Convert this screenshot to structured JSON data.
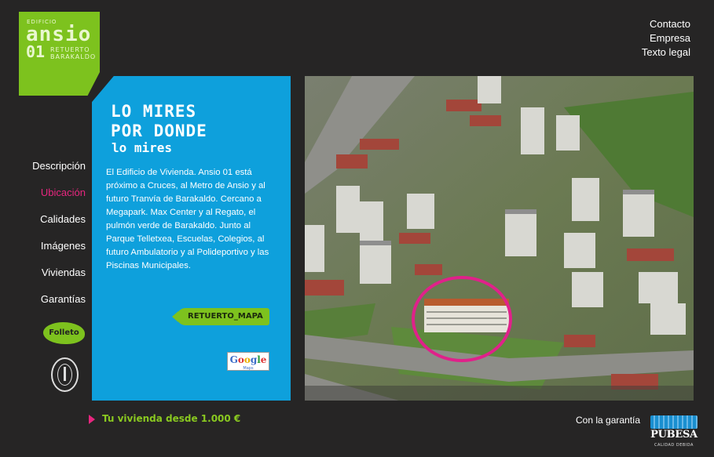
{
  "logo": {
    "small": "EDIFICIO",
    "big": "ansio",
    "number": "01",
    "sub_line1": "RETUERTO",
    "sub_line2": "BARAKALDO"
  },
  "topnav": [
    "Contacto",
    "Empresa",
    "Texto legal"
  ],
  "leftmenu": {
    "items": [
      {
        "label": "Descripción",
        "active": false
      },
      {
        "label": "Ubicación",
        "active": true
      },
      {
        "label": "Calidades",
        "active": false
      },
      {
        "label": "Imágenes",
        "active": false
      },
      {
        "label": "Viviendas",
        "active": false
      },
      {
        "label": "Garantías",
        "active": false
      }
    ],
    "folleto": "Folleto"
  },
  "panel": {
    "headline_line1": "LO MIRES",
    "headline_line2": "POR DONDE",
    "headline_sub": "lo mires",
    "body": "El Edificio de Vivienda. Ansio 01 está próximo a Cruces, al Metro de Ansio y al futuro Tranvía de Barakaldo. Cercano a Megapark. Max Center y al Regato, el pulmón verde de Barakaldo. Junto al Parque Telletxea, Escuelas, Colegios, al futuro Ambulatorio y al Polideportivo y las Piscinas Municipales.",
    "map_button": "RETUERTO_MAPA",
    "gmaps_label": "Google",
    "gmaps_sub": "Maps"
  },
  "footer": {
    "promo": "Tu vivienda desde 1.000 €",
    "guarantee": "Con la garantía",
    "pubesa_name": "PUBESA",
    "pubesa_tag": "CALIDAD DEBIDA"
  },
  "colors": {
    "background": "#262525",
    "accent_green": "#7dc21e",
    "panel_blue": "#0ea0dc",
    "active_pink": "#e8267f"
  }
}
